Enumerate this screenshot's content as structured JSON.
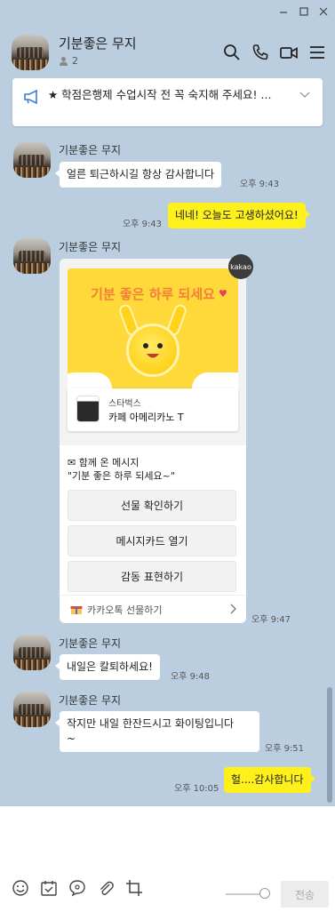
{
  "header": {
    "title": "기분좋은 무지",
    "member_count": "2"
  },
  "notice": {
    "text": "★ 학점은행제 수업시작 전 꼭 숙지해 주세요! ..."
  },
  "messages": {
    "m1": {
      "sender": "기분좋은 무지",
      "text": "얼른 퇴근하시길 항상 감사합니다",
      "time": "오후 9:43"
    },
    "m2": {
      "text": "네네! 오늘도 고생하셨어요!",
      "time": "오후 9:43"
    },
    "m3": {
      "sender": "기분좋은 무지",
      "time": "오후 9:47"
    },
    "m4": {
      "sender": "기분좋은 무지",
      "text": "내일은 칼퇴하세요!",
      "time": "오후 9:48"
    },
    "m5": {
      "sender": "기분좋은 무지",
      "text": "작지만 내일 한잔드시고 화이팅입니다\n~",
      "time": "오후 9:51"
    },
    "m6": {
      "text": "헐....감사합니다",
      "time": "오후 10:05"
    }
  },
  "gift": {
    "badge": "kakao",
    "banner_title": "기분 좋은 하루 되세요",
    "brand": "스타벅스",
    "product": "카페 아메리카노 T",
    "note_line1": "✉ 함께 온 메시지",
    "note_line2": "\"기분 좋은 하루 되세요~\"",
    "btn_confirm": "선물 확인하기",
    "btn_card": "메시지카드 열기",
    "btn_react": "감동 표현하기",
    "footer": "카카오톡 선물하기"
  },
  "input": {
    "send_label": "전송"
  },
  "colors": {
    "background": "#bacee0",
    "my_bubble": "#fef01b",
    "other_bubble": "#ffffff"
  },
  "icons": {
    "header": [
      "search-icon",
      "phone-icon",
      "video-icon",
      "menu-icon"
    ],
    "toolbar": [
      "emoji-icon",
      "calendar-icon",
      "bubble-icon",
      "attach-icon",
      "crop-icon"
    ]
  }
}
